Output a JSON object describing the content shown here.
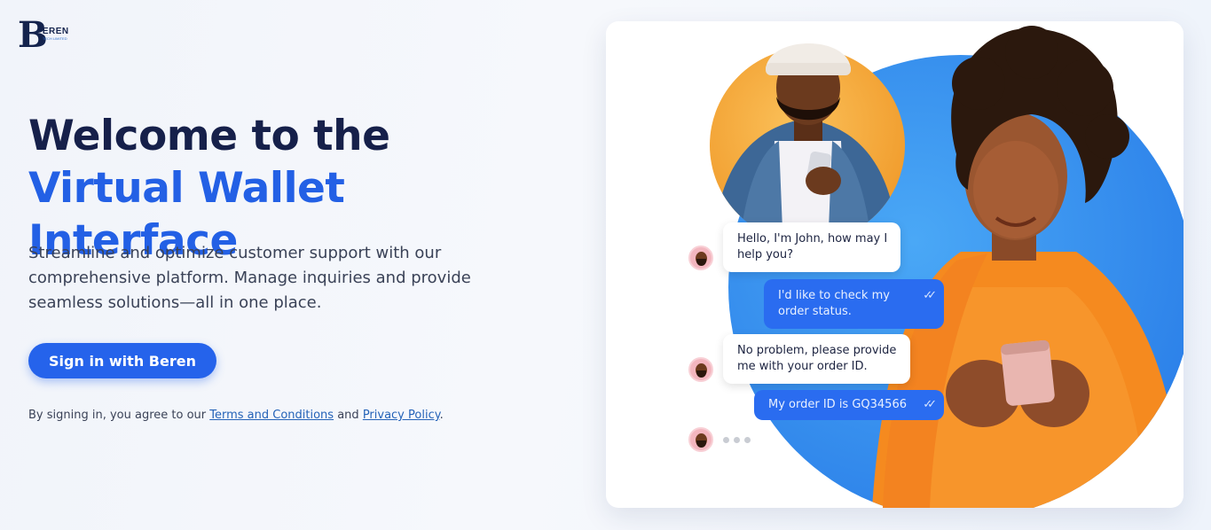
{
  "brand": {
    "initial": "B",
    "name": "EREN",
    "tagline": "TECH LIMITED"
  },
  "hero": {
    "title_line1": "Welcome to the",
    "title_line2": "Virtual Wallet Interface",
    "description": "Streamline and optimize customer support with our comprehensive platform. Manage inquiries and provide seamless solutions—all in one place."
  },
  "signin": {
    "label": "Sign in with Beren"
  },
  "terms": {
    "prefix": "By signing in, you agree to our ",
    "terms_link": "Terms and Conditions",
    "middle": " and ",
    "privacy_link": "Privacy Policy",
    "suffix": "."
  },
  "chat": {
    "messages": [
      {
        "from": "agent",
        "text": "Hello, I'm John, how may I help you?"
      },
      {
        "from": "user",
        "text": "I'd like to check my order status."
      },
      {
        "from": "agent",
        "text": "No problem, please provide me with your order ID."
      },
      {
        "from": "user",
        "text": "My order ID is GQ34566"
      }
    ]
  },
  "colors": {
    "accent": "#2563eb",
    "heading": "#16204a",
    "user_bubble": "#2a6cf0",
    "orange_circle": "#f6a93b",
    "blue_circle": "#2f8ff0"
  },
  "icons": [
    "double-check-icon",
    "typing-dots-icon",
    "agent-avatar-icon"
  ]
}
